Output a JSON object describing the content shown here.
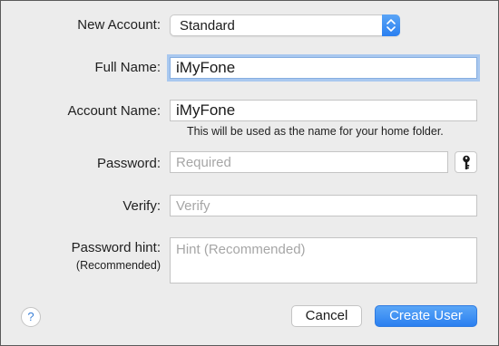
{
  "form": {
    "new_account": {
      "label": "New Account:",
      "selected": "Standard"
    },
    "full_name": {
      "label": "Full Name:",
      "value": "iMyFone"
    },
    "account_name": {
      "label": "Account Name:",
      "value": "iMyFone",
      "note": "This will be used as the name for your home folder."
    },
    "password": {
      "label": "Password:",
      "placeholder": "Required",
      "key_icon": "key-icon"
    },
    "verify": {
      "label": "Verify:",
      "placeholder": "Verify"
    },
    "password_hint": {
      "label": "Password hint:",
      "sublabel": "(Recommended)",
      "placeholder": "Hint (Recommended)"
    }
  },
  "buttons": {
    "help": "?",
    "cancel": "Cancel",
    "create_user": "Create User"
  },
  "colors": {
    "accent": "#2a7ff0",
    "focus_ring": "#a9c8ef",
    "background": "#ececec"
  }
}
